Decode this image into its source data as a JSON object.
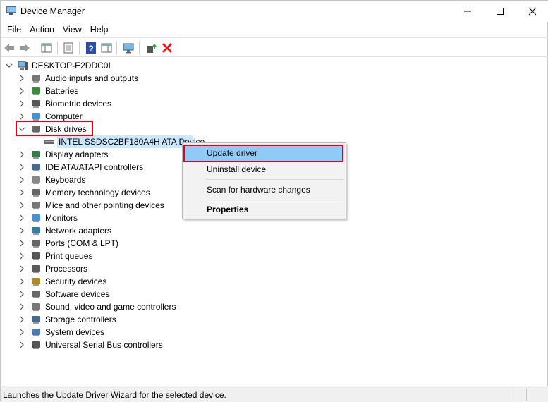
{
  "window": {
    "title": "Device Manager"
  },
  "menu": [
    "File",
    "Action",
    "View",
    "Help"
  ],
  "tree": {
    "root": "DESKTOP-E2DDC0I",
    "categories": [
      {
        "label": "Audio inputs and outputs",
        "icon": "speaker-icon"
      },
      {
        "label": "Batteries",
        "icon": "battery-icon"
      },
      {
        "label": "Biometric devices",
        "icon": "fingerprint-icon"
      },
      {
        "label": "Computer",
        "icon": "computer-icon"
      },
      {
        "label": "Disk drives",
        "icon": "disk-drive-icon",
        "expanded": true
      },
      {
        "label": "Display adapters",
        "icon": "display-adapter-icon"
      },
      {
        "label": "IDE ATA/ATAPI controllers",
        "icon": "ide-controller-icon"
      },
      {
        "label": "Keyboards",
        "icon": "keyboard-icon"
      },
      {
        "label": "Memory technology devices",
        "icon": "memory-icon"
      },
      {
        "label": "Mice and other pointing devices",
        "icon": "mouse-icon"
      },
      {
        "label": "Monitors",
        "icon": "monitor-icon"
      },
      {
        "label": "Network adapters",
        "icon": "network-adapter-icon"
      },
      {
        "label": "Ports (COM & LPT)",
        "icon": "port-icon"
      },
      {
        "label": "Print queues",
        "icon": "printer-icon"
      },
      {
        "label": "Processors",
        "icon": "processor-icon"
      },
      {
        "label": "Security devices",
        "icon": "security-key-icon"
      },
      {
        "label": "Software devices",
        "icon": "software-device-icon"
      },
      {
        "label": "Sound, video and game controllers",
        "icon": "sound-icon"
      },
      {
        "label": "Storage controllers",
        "icon": "storage-controller-icon"
      },
      {
        "label": "System devices",
        "icon": "system-device-icon"
      },
      {
        "label": "Universal Serial Bus controllers",
        "icon": "usb-icon"
      }
    ],
    "disk_child": "INTEL SSDSC2BF180A4H ATA Device"
  },
  "context_menu": {
    "items": [
      "Update driver",
      "Uninstall device",
      "Scan for hardware changes",
      "Properties"
    ],
    "active": "Update driver"
  },
  "status": {
    "text": "Launches the Update Driver Wizard for the selected device."
  },
  "colors": {
    "highlight_box": "#e0001a",
    "selection": "#cce8ff",
    "menu_active": "#91c9f7"
  }
}
